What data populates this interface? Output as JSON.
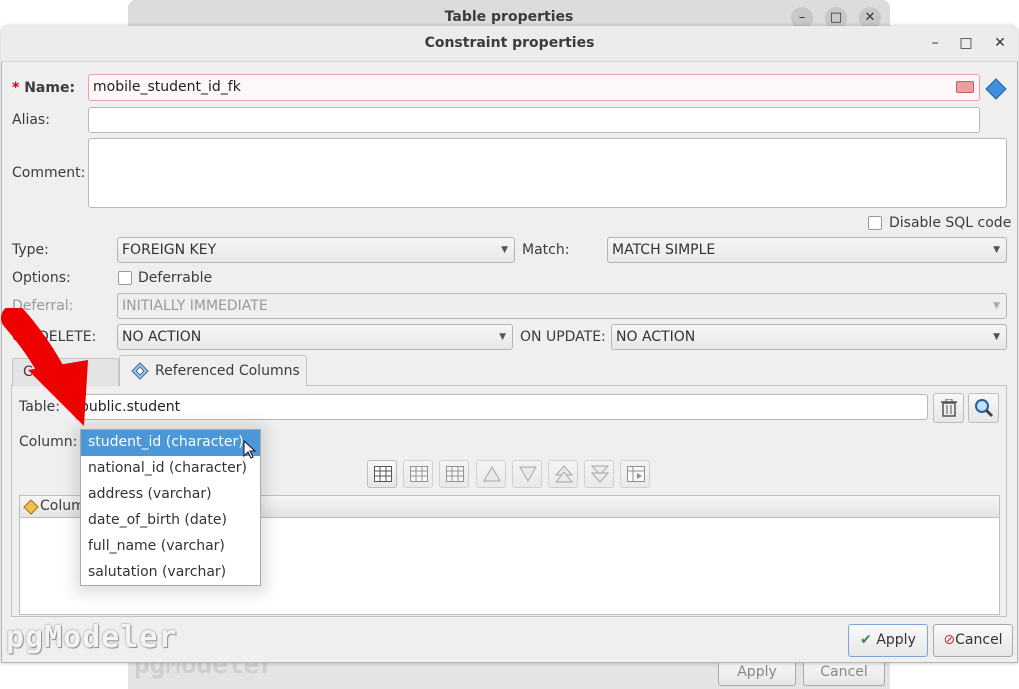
{
  "back_window": {
    "title": "Table properties",
    "apply_label": "Apply",
    "cancel_label": "Cancel",
    "watermark": "pgModeler"
  },
  "window": {
    "title": "Constraint properties",
    "minimize": "–",
    "maximize": "□",
    "close": "✕"
  },
  "form": {
    "name_required_marker": "*",
    "name_label": "Name:",
    "name_value": "mobile_student_id_fk",
    "alias_label": "Alias:",
    "alias_value": "",
    "comment_label": "Comment:",
    "comment_value": "",
    "disable_sql_label": "Disable SQL code",
    "type_label": "Type:",
    "type_value": "FOREIGN KEY",
    "match_label": "Match:",
    "match_value": "MATCH SIMPLE",
    "options_label": "Options:",
    "deferrable_label": "Deferrable",
    "deferral_label": "Deferral:",
    "deferral_value": "INITIALLY IMMEDIATE",
    "on_delete_label": "ON DELETE:",
    "on_delete_value": "NO ACTION",
    "on_update_label": "ON UPDATE:",
    "on_update_value": "NO ACTION"
  },
  "tabs": [
    {
      "label": "Columns"
    },
    {
      "label": "Referenced Columns"
    }
  ],
  "ref_tab": {
    "table_label": "Table:",
    "table_value": "public.student",
    "column_label": "Column:",
    "grid_header": "Column"
  },
  "column_options": [
    "student_id (character)",
    "national_id (character)",
    "address (varchar)",
    "date_of_birth (date)",
    "full_name (varchar)",
    "salutation (varchar)"
  ],
  "selected_option": "student_id (character)",
  "buttons": {
    "apply": "Apply",
    "cancel": "Cancel"
  },
  "watermark": "pgModeler",
  "colors": {
    "selection": "#4b97d8",
    "required": "#d40000",
    "arrow": "#ee0000"
  }
}
